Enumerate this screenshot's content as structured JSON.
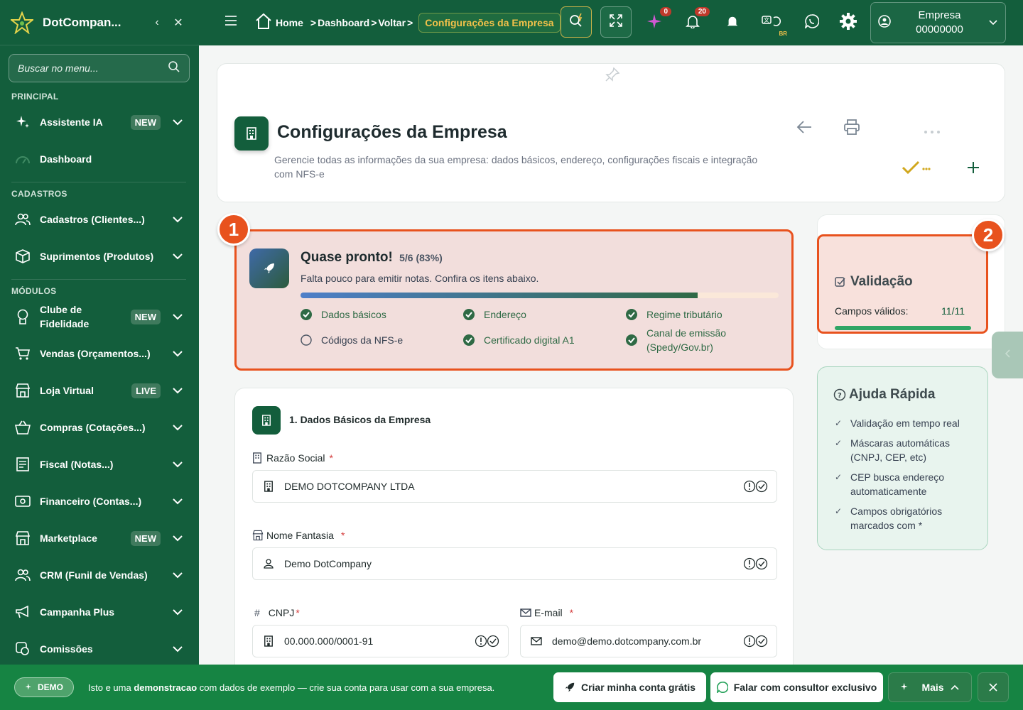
{
  "sidebar": {
    "brand": "DotCompan...",
    "search_placeholder": "Buscar no menu...",
    "sections": {
      "principal": "PRINCIPAL",
      "cadastros": "CADASTROS",
      "modulos": "MÓDULOS"
    },
    "items": [
      {
        "label": "Assistente IA",
        "badge": "NEW",
        "icon": "sparkles-icon"
      },
      {
        "label": "Dashboard",
        "icon": "gauge-icon"
      },
      {
        "label": "Cadastros (Clientes...)",
        "icon": "users-icon"
      },
      {
        "label": "Suprimentos (Produtos)",
        "icon": "box-icon"
      },
      {
        "label": "Clube de Fidelidade",
        "badge": "NEW",
        "icon": "medal-icon"
      },
      {
        "label": "Vendas (Orçamentos...)",
        "icon": "cart-icon"
      },
      {
        "label": "Loja Virtual",
        "badge": "LIVE",
        "icon": "store-icon"
      },
      {
        "label": "Compras (Cotações...)",
        "icon": "basket-icon"
      },
      {
        "label": "Fiscal (Notas...)",
        "icon": "receipt-icon"
      },
      {
        "label": "Financeiro (Contas...)",
        "icon": "cash-icon"
      },
      {
        "label": "Marketplace",
        "badge": "NEW",
        "icon": "shop-icon"
      },
      {
        "label": "CRM (Funil de Vendas)",
        "icon": "users-icon"
      },
      {
        "label": "Campanha Plus",
        "icon": "megaphone-icon"
      },
      {
        "label": "Comissões",
        "icon": "coins-icon"
      }
    ]
  },
  "topbar": {
    "breadcrumb": {
      "home": "Home",
      "dashboard": "Dashboard",
      "voltar": "Voltar",
      "current": "Configurações da Empresa"
    },
    "sparkle_count": "0",
    "notifications_count": "20",
    "lang_code": "BR",
    "company": {
      "name": "Empresa",
      "code": "00000000"
    }
  },
  "header": {
    "title": "Configurações da Empresa",
    "description": "Gerencie todas as informações da sua empresa: dados básicos, endereço, configurações fiscais e integração com NFS-e"
  },
  "progress": {
    "title": "Quase pronto!",
    "count": "5/6 (83%)",
    "fraction": 0.83,
    "subtitle": "Falta pouco para emitir notas. Confira os itens abaixo.",
    "items": [
      {
        "label": "Dados básicos",
        "done": true
      },
      {
        "label": "Endereço",
        "done": true
      },
      {
        "label": "Regime tributário",
        "done": true
      },
      {
        "label": "Códigos da NFS-e",
        "done": false
      },
      {
        "label": "Certificado digital A1",
        "done": true
      },
      {
        "label": "Canal de emissão (Spedy/Gov.br)",
        "done": true
      }
    ]
  },
  "badges": {
    "one": "1",
    "two": "2"
  },
  "validation": {
    "title": "Validação",
    "label": "Campos válidos:",
    "value": "11/11"
  },
  "help": {
    "title": "Ajuda Rápida",
    "items": [
      "Validação em tempo real",
      "Máscaras automáticas (CNPJ, CEP, etc)",
      "CEP busca endereço automaticamente",
      "Campos obrigatórios marcados com *"
    ]
  },
  "form": {
    "section_title": "1. Dados Básicos da Empresa",
    "razao_social": {
      "label": "Razão Social",
      "value": "DEMO DOTCOMPANY LTDA"
    },
    "nome_fantasia": {
      "label": "Nome Fantasia",
      "value": "Demo DotCompany"
    },
    "cnpj": {
      "label": "CNPJ",
      "value": "00.000.000/0001-91"
    },
    "email": {
      "label": "E-mail",
      "value": "demo@demo.dotcompany.com.br"
    },
    "required_mark": "*",
    "hash_mark": "#"
  },
  "banner": {
    "demo": "DEMO",
    "text_prefix": "Isto e uma ",
    "text_bold": "demonstracao",
    "text_suffix": " com dados de exemplo — crie sua conta para usar com a sua empresa.",
    "create_account": "Criar minha conta grátis",
    "consultant": "Falar com consultor exclusivo",
    "more": "Mais"
  },
  "colors": {
    "brand": "#135e3c",
    "accent": "#e8521e",
    "highlight": "#f2c14a"
  }
}
